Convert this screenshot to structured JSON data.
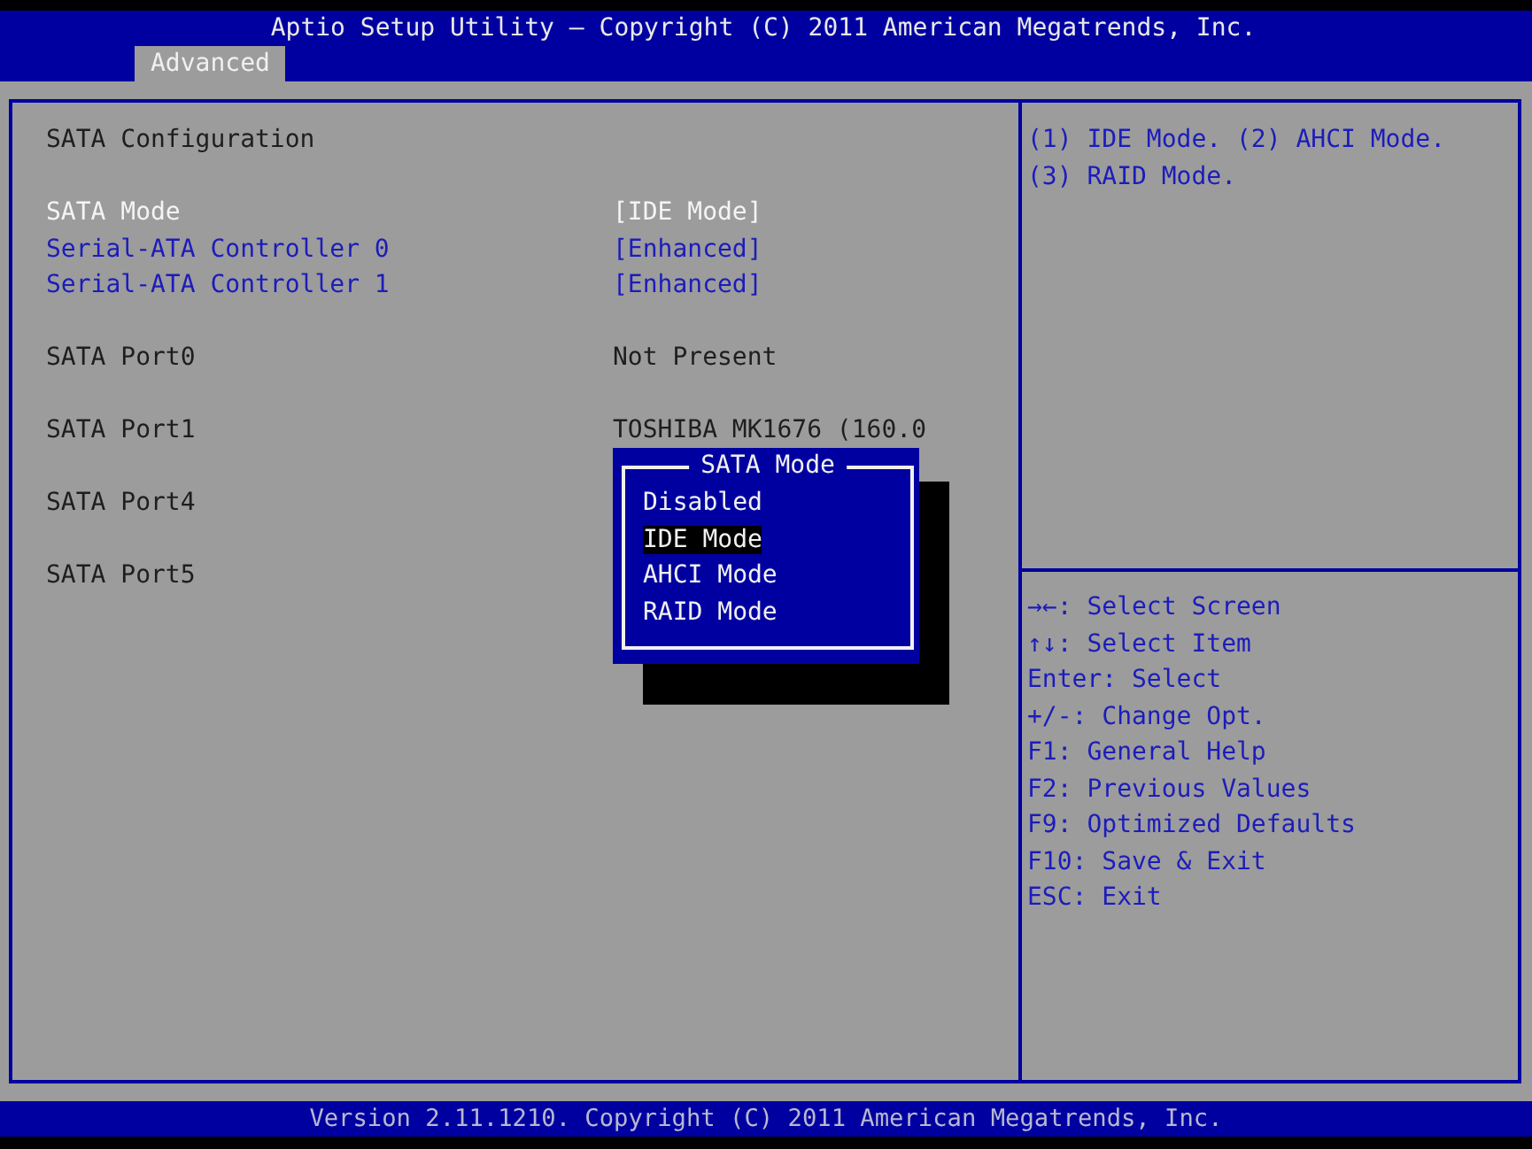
{
  "header": {
    "title": "Aptio Setup Utility – Copyright (C) 2011 American Megatrends, Inc.",
    "tabs": [
      {
        "label": "Advanced",
        "selected": true
      }
    ]
  },
  "sections": [
    {
      "rows": [
        {
          "kind": "heading",
          "label": "SATA Configuration"
        }
      ]
    },
    {
      "rows": [
        {
          "kind": "setting",
          "label": "SATA Mode",
          "value": "[IDE Mode]",
          "selected": true
        },
        {
          "kind": "setting",
          "label": "Serial-ATA Controller 0",
          "value": "[Enhanced]",
          "selected": false
        },
        {
          "kind": "setting",
          "label": "Serial-ATA Controller 1",
          "value": "[Enhanced]",
          "selected": false
        }
      ]
    },
    {
      "rows": [
        {
          "kind": "info",
          "label": "SATA Port0",
          "value": "Not Present"
        }
      ]
    },
    {
      "rows": [
        {
          "kind": "info",
          "label": "SATA Port1",
          "value": "TOSHIBA MK1676 (160.0"
        }
      ]
    },
    {
      "rows": [
        {
          "kind": "info",
          "label": "SATA Port4"
        }
      ]
    },
    {
      "rows": [
        {
          "kind": "info",
          "label": "SATA Port5"
        }
      ]
    }
  ],
  "popup": {
    "title": "SATA Mode",
    "options": [
      {
        "label": "Disabled",
        "selected": false
      },
      {
        "label": "IDE Mode",
        "selected": true
      },
      {
        "label": "AHCI Mode",
        "selected": false
      },
      {
        "label": "RAID Mode",
        "selected": false
      }
    ]
  },
  "help": "(1) IDE Mode. (2) AHCI Mode. (3) RAID Mode.",
  "keys": [
    "→←: Select Screen",
    "↑↓: Select Item",
    "Enter: Select",
    "+/-: Change Opt.",
    "F1: General Help",
    "F2: Previous Values",
    "F9: Optimized Defaults",
    "F10: Save & Exit",
    "ESC: Exit"
  ],
  "footer": "Version 2.11.1210. Copyright (C) 2011 American Megatrends, Inc."
}
